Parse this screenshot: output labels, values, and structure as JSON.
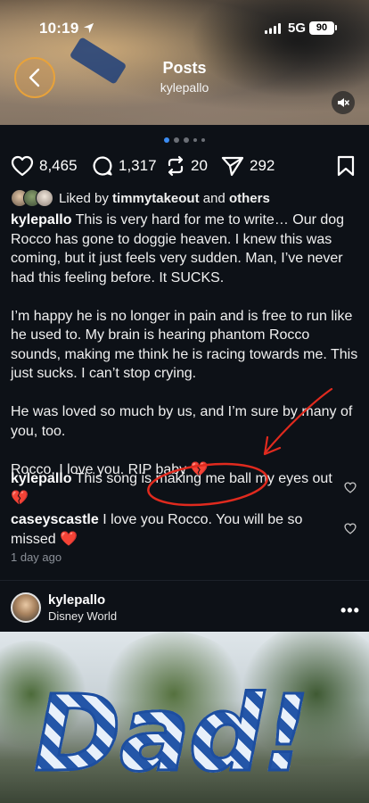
{
  "status_bar": {
    "time": "10:19",
    "network": "5G",
    "battery": "90"
  },
  "header": {
    "title": "Posts",
    "subtitle": "kylepallo"
  },
  "actions": {
    "likes": "8,465",
    "comments": "1,317",
    "reposts": "20",
    "shares": "292"
  },
  "liked_by": {
    "prefix": "Liked by ",
    "user": "timmytakeout",
    "mid": " and ",
    "others": "others"
  },
  "caption": {
    "user": "kylepallo",
    "para1": " This is very hard for me to write… Our dog Rocco has gone to doggie heaven. I knew this was coming, but it just feels very sudden. Man, I’ve never had this feeling before. It SUCKS.",
    "para2": "I’m happy he is no longer in pain and is free to run like he used to. My brain is hearing phantom Rocco sounds, making me think he is racing towards me. This just sucks. I can’t stop crying.",
    "para3": "He was loved so much by us, and I’m sure by many of you, too.",
    "para4": "Rocco, I love you. RIP baby 💔"
  },
  "comments": [
    {
      "user": "kylepallo",
      "text": " This song is making me ball my eyes out 💔"
    },
    {
      "user": "caseyscastle",
      "text": " I love you Rocco. You will be so missed ❤️"
    }
  ],
  "time_ago": "1 day ago",
  "next_post": {
    "user": "kylepallo",
    "location": "Disney World",
    "more": "•••",
    "photo_text": "Dad!"
  },
  "colors": {
    "background": "#0d1117",
    "accent_blue": "#3b8cf2",
    "annotation_red": "#e02a1e",
    "back_button_ring": "#e8a23a"
  }
}
